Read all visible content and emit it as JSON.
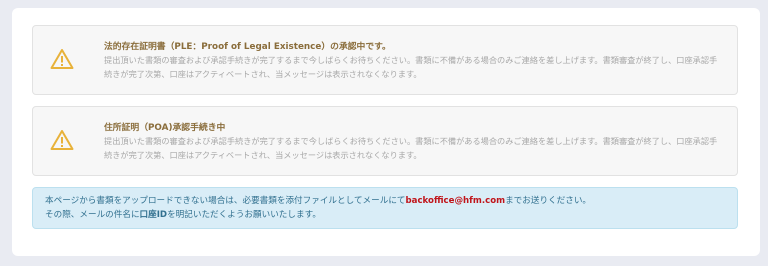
{
  "alerts": [
    {
      "title": "法的存在証明書（PLE：Proof of Legal Existence）の承認中です。",
      "body": "提出頂いた書類の審査および承認手続きが完了するまで今しばらくお待ちください。書類に不備がある場合のみご連絡を差し上げます。書類審査が終了し、口座承認手続きが完了次第、口座はアクティベートされ、当メッセージは表示されなくなります。",
      "icon": "warning-triangle-icon"
    },
    {
      "title": "住所証明（POA)承認手続き中",
      "body": "提出頂いた書類の審査および承認手続きが完了するまで今しばらくお待ちください。書類に不備がある場合のみご連絡を差し上げます。書類審査が終了し、口座承認手続きが完了次第、口座はアクティベートされ、当メッセージは表示されなくなります。",
      "icon": "warning-triangle-icon"
    }
  ],
  "info": {
    "line1_prefix": "本ページから書類をアップロードできない場合は、必要書類を添付ファイルとしてメールにて",
    "email": "backoffice@hfm.com",
    "line1_suffix": "までお送りください。",
    "line2_prefix": "その際、メールの件名に",
    "line2_strong": "口座ID",
    "line2_suffix": "を明記いただくようお願いいたします。"
  },
  "colors": {
    "warning_title": "#8a6d3b",
    "warning_icon": "#e8b23a",
    "info_text": "#31708f",
    "info_bg": "#d9edf7",
    "email": "#c0141a"
  }
}
